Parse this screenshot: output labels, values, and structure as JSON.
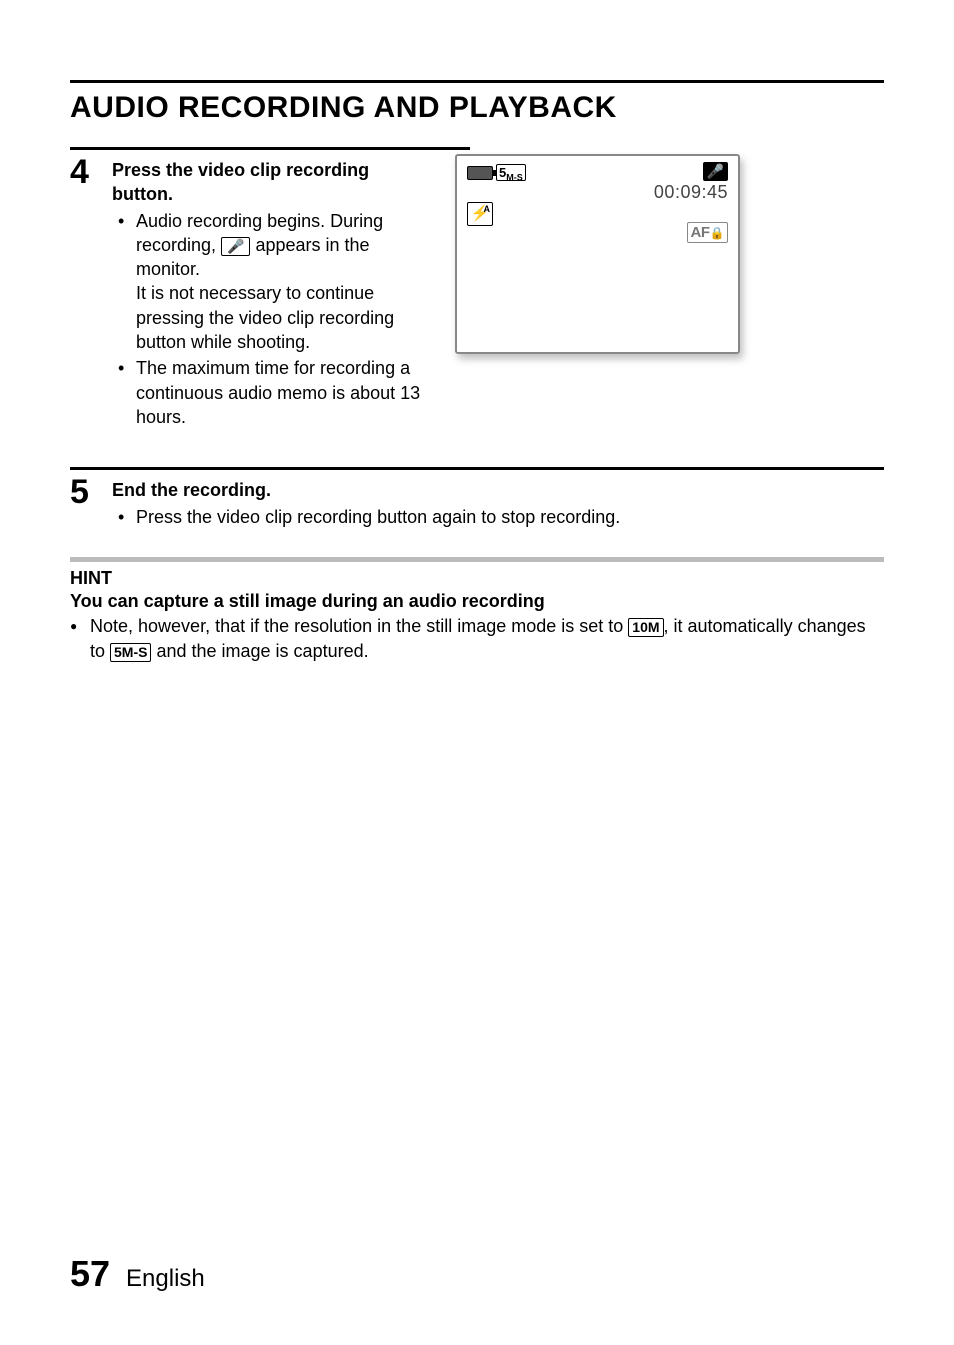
{
  "title": "AUDIO RECORDING AND PLAYBACK",
  "step4": {
    "number": "4",
    "heading": "Press the video clip recording button.",
    "bullet1_before": "Audio recording begins. During recording, ",
    "bullet1_icon": "🎤",
    "bullet1_after": " appears in the monitor.",
    "continuation": "It is not necessary to continue pressing the video clip recording button while shooting.",
    "bullet2": "The maximum time for recording a continuous audio memo is about 13 hours."
  },
  "screen": {
    "res_badge": "5",
    "res_suffix": "M-S",
    "timer": "00:09:45",
    "flash_symbol": "⚡",
    "af_text": "AF",
    "mic_symbol": "🎤"
  },
  "step5": {
    "number": "5",
    "heading": "End the recording.",
    "bullet1": "Press the video clip recording button again to stop recording."
  },
  "hint": {
    "label": "HINT",
    "subhead": "You can capture a still image during an audio recording",
    "text_before": "Note, however, that if the resolution in the still image mode is set to ",
    "badge1": "10M",
    "text_mid": ", it automatically changes to ",
    "badge2": "5M-S",
    "text_after": " and the image is captured."
  },
  "footer": {
    "page": "57",
    "lang": "English"
  }
}
